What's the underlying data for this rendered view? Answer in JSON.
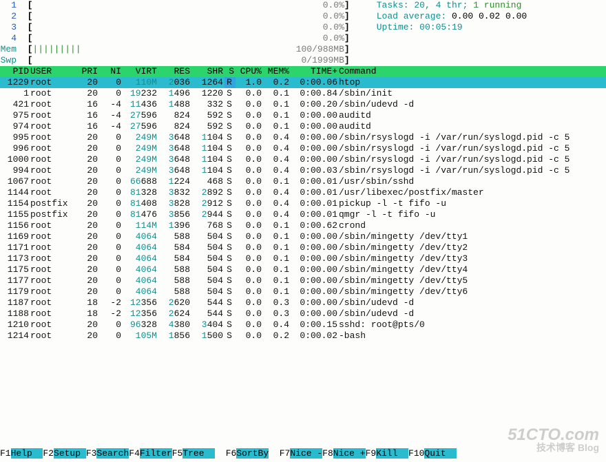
{
  "meters": {
    "cpu": [
      {
        "label": "1",
        "bar": "[",
        "fill": "",
        "pct": "0.0%",
        "end": "]"
      },
      {
        "label": "2",
        "bar": "[",
        "fill": "",
        "pct": "0.0%",
        "end": "]"
      },
      {
        "label": "3",
        "bar": "[",
        "fill": "",
        "pct": "0.0%",
        "end": "]"
      },
      {
        "label": "4",
        "bar": "[",
        "fill": "",
        "pct": "0.0%",
        "end": "]"
      }
    ],
    "mem": {
      "label": "Mem",
      "bar": "[",
      "fill": "|||||||||",
      "val": "100/988MB",
      "end": "]"
    },
    "swp": {
      "label": "Swp",
      "bar": "[",
      "fill": "",
      "val": "0/1999MB",
      "end": "]"
    }
  },
  "status": {
    "tasks": "Tasks: 20, 4 thr; 1 running",
    "load_label": "Load average:",
    "load": "0.00 0.02 0.00",
    "uptime_label": "Uptime:",
    "uptime": "00:05:19"
  },
  "cols": [
    "PID",
    "USER",
    "PRI",
    "NI",
    "VIRT",
    "RES",
    "SHR",
    "S",
    "CPU%",
    "MEM%",
    "TIME+",
    "Command"
  ],
  "procs": [
    {
      "pid": "1229",
      "user": "root",
      "pri": "20",
      "ni": "0",
      "virt": "110M",
      "res": "2036",
      "shr": "1264",
      "s": "R",
      "cpu": "1.0",
      "mem": "0.2",
      "time": "0:00.06",
      "cmd": "htop",
      "sel": true,
      "virt_cyan": true
    },
    {
      "pid": "1",
      "user": "root",
      "pri": "20",
      "ni": "0",
      "virt": "19232",
      "res": "1496",
      "shr": "1220",
      "s": "S",
      "cpu": "0.0",
      "mem": "0.1",
      "time": "0:00.84",
      "cmd": "/sbin/init",
      "virt_split": "19"
    },
    {
      "pid": "421",
      "user": "root",
      "pri": "16",
      "ni": "-4",
      "virt": "11436",
      "res": "1488",
      "shr": "332",
      "s": "S",
      "cpu": "0.0",
      "mem": "0.1",
      "time": "0:00.20",
      "cmd": "/sbin/udevd -d",
      "ni_red": true,
      "virt_split": "11"
    },
    {
      "pid": "975",
      "user": "root",
      "pri": "16",
      "ni": "-4",
      "virt": "27596",
      "res": "824",
      "shr": "592",
      "s": "S",
      "cpu": "0.0",
      "mem": "0.1",
      "time": "0:00.00",
      "cmd": "auditd",
      "ni_red": true,
      "virt_split": "27"
    },
    {
      "pid": "974",
      "user": "root",
      "pri": "16",
      "ni": "-4",
      "virt": "27596",
      "res": "824",
      "shr": "592",
      "s": "S",
      "cpu": "0.0",
      "mem": "0.1",
      "time": "0:00.00",
      "cmd": "auditd",
      "ni_red": true,
      "virt_split": "27"
    },
    {
      "pid": "995",
      "user": "root",
      "pri": "20",
      "ni": "0",
      "virt": "249M",
      "res": "3648",
      "shr": "1104",
      "s": "S",
      "cpu": "0.0",
      "mem": "0.4",
      "time": "0:00.00",
      "cmd": "/sbin/rsyslogd -i /var/run/syslogd.pid -c 5",
      "virt_cyan": true,
      "shr_split": "1"
    },
    {
      "pid": "996",
      "user": "root",
      "pri": "20",
      "ni": "0",
      "virt": "249M",
      "res": "3648",
      "shr": "1104",
      "s": "S",
      "cpu": "0.0",
      "mem": "0.4",
      "time": "0:00.00",
      "cmd": "/sbin/rsyslogd -i /var/run/syslogd.pid -c 5",
      "virt_cyan": true,
      "shr_split": "1"
    },
    {
      "pid": "1000",
      "user": "root",
      "pri": "20",
      "ni": "0",
      "virt": "249M",
      "res": "3648",
      "shr": "1104",
      "s": "S",
      "cpu": "0.0",
      "mem": "0.4",
      "time": "0:00.00",
      "cmd": "/sbin/rsyslogd -i /var/run/syslogd.pid -c 5",
      "virt_cyan": true,
      "shr_split": "1"
    },
    {
      "pid": "994",
      "user": "root",
      "pri": "20",
      "ni": "0",
      "virt": "249M",
      "res": "3648",
      "shr": "1104",
      "s": "S",
      "cpu": "0.0",
      "mem": "0.4",
      "time": "0:00.03",
      "cmd": "/sbin/rsyslogd -i /var/run/syslogd.pid -c 5",
      "virt_cyan": true,
      "shr_split": "1"
    },
    {
      "pid": "1067",
      "user": "root",
      "pri": "20",
      "ni": "0",
      "virt": "66688",
      "res": "1224",
      "shr": "468",
      "s": "S",
      "cpu": "0.0",
      "mem": "0.1",
      "time": "0:00.01",
      "cmd": "/usr/sbin/sshd",
      "virt_split": "66"
    },
    {
      "pid": "1144",
      "user": "root",
      "pri": "20",
      "ni": "0",
      "virt": "81328",
      "res": "3832",
      "shr": "2892",
      "s": "S",
      "cpu": "0.0",
      "mem": "0.4",
      "time": "0:00.01",
      "cmd": "/usr/libexec/postfix/master",
      "virt_split": "81",
      "shr_split": "2"
    },
    {
      "pid": "1154",
      "user": "postfix",
      "pri": "20",
      "ni": "0",
      "virt": "81408",
      "res": "3828",
      "shr": "2912",
      "s": "S",
      "cpu": "0.0",
      "mem": "0.4",
      "time": "0:00.01",
      "cmd": "pickup -l -t fifo -u",
      "virt_split": "81",
      "shr_split": "2",
      "user_grey": true
    },
    {
      "pid": "1155",
      "user": "postfix",
      "pri": "20",
      "ni": "0",
      "virt": "81476",
      "res": "3856",
      "shr": "2944",
      "s": "S",
      "cpu": "0.0",
      "mem": "0.4",
      "time": "0:00.01",
      "cmd": "qmgr -l -t fifo -u",
      "virt_split": "81",
      "shr_split": "2",
      "user_grey": true
    },
    {
      "pid": "1156",
      "user": "root",
      "pri": "20",
      "ni": "0",
      "virt": "114M",
      "res": "1396",
      "shr": "768",
      "s": "S",
      "cpu": "0.0",
      "mem": "0.1",
      "time": "0:00.62",
      "cmd": "crond",
      "virt_cyan": true
    },
    {
      "pid": "1169",
      "user": "root",
      "pri": "20",
      "ni": "0",
      "virt": "4064",
      "res": "588",
      "shr": "504",
      "s": "S",
      "cpu": "0.0",
      "mem": "0.1",
      "time": "0:00.00",
      "cmd": "/sbin/mingetty /dev/tty1",
      "virt_cyan": true
    },
    {
      "pid": "1171",
      "user": "root",
      "pri": "20",
      "ni": "0",
      "virt": "4064",
      "res": "584",
      "shr": "504",
      "s": "S",
      "cpu": "0.0",
      "mem": "0.1",
      "time": "0:00.00",
      "cmd": "/sbin/mingetty /dev/tty2",
      "virt_cyan": true
    },
    {
      "pid": "1173",
      "user": "root",
      "pri": "20",
      "ni": "0",
      "virt": "4064",
      "res": "584",
      "shr": "504",
      "s": "S",
      "cpu": "0.0",
      "mem": "0.1",
      "time": "0:00.00",
      "cmd": "/sbin/mingetty /dev/tty3",
      "virt_cyan": true
    },
    {
      "pid": "1175",
      "user": "root",
      "pri": "20",
      "ni": "0",
      "virt": "4064",
      "res": "588",
      "shr": "504",
      "s": "S",
      "cpu": "0.0",
      "mem": "0.1",
      "time": "0:00.00",
      "cmd": "/sbin/mingetty /dev/tty4",
      "virt_cyan": true
    },
    {
      "pid": "1177",
      "user": "root",
      "pri": "20",
      "ni": "0",
      "virt": "4064",
      "res": "588",
      "shr": "504",
      "s": "S",
      "cpu": "0.0",
      "mem": "0.1",
      "time": "0:00.00",
      "cmd": "/sbin/mingetty /dev/tty5",
      "virt_cyan": true
    },
    {
      "pid": "1179",
      "user": "root",
      "pri": "20",
      "ni": "0",
      "virt": "4064",
      "res": "588",
      "shr": "504",
      "s": "S",
      "cpu": "0.0",
      "mem": "0.1",
      "time": "0:00.00",
      "cmd": "/sbin/mingetty /dev/tty6",
      "virt_cyan": true
    },
    {
      "pid": "1187",
      "user": "root",
      "pri": "18",
      "ni": "-2",
      "virt": "12356",
      "res": "2620",
      "shr": "544",
      "s": "S",
      "cpu": "0.0",
      "mem": "0.3",
      "time": "0:00.00",
      "cmd": "/sbin/udevd -d",
      "ni_red": true,
      "virt_split": "12"
    },
    {
      "pid": "1188",
      "user": "root",
      "pri": "18",
      "ni": "-2",
      "virt": "12356",
      "res": "2624",
      "shr": "544",
      "s": "S",
      "cpu": "0.0",
      "mem": "0.3",
      "time": "0:00.00",
      "cmd": "/sbin/udevd -d",
      "ni_red": true,
      "virt_split": "12"
    },
    {
      "pid": "1210",
      "user": "root",
      "pri": "20",
      "ni": "0",
      "virt": "96328",
      "res": "4380",
      "shr": "3404",
      "s": "S",
      "cpu": "0.0",
      "mem": "0.4",
      "time": "0:00.15",
      "cmd": "sshd: root@pts/0",
      "virt_split": "96",
      "shr_split": "3"
    },
    {
      "pid": "1214",
      "user": "root",
      "pri": "20",
      "ni": "0",
      "virt": "105M",
      "res": "1856",
      "shr": "1500",
      "s": "S",
      "cpu": "0.0",
      "mem": "0.2",
      "time": "0:00.02",
      "cmd": "-bash",
      "virt_cyan": true,
      "shr_split": "1"
    }
  ],
  "fkeys": [
    {
      "k": "F1",
      "l": "Help"
    },
    {
      "k": "F2",
      "l": "Setup"
    },
    {
      "k": "F3",
      "l": "Search"
    },
    {
      "k": "F4",
      "l": "Filter"
    },
    {
      "k": "F5",
      "l": "Tree"
    },
    {
      "k": "F6",
      "l": "SortBy"
    },
    {
      "k": "F7",
      "l": "Nice -"
    },
    {
      "k": "F8",
      "l": "Nice +"
    },
    {
      "k": "F9",
      "l": "Kill"
    },
    {
      "k": "F10",
      "l": "Quit"
    }
  ],
  "watermark": {
    "big": "51CTO.com",
    "small": "技术博客  Blog"
  }
}
